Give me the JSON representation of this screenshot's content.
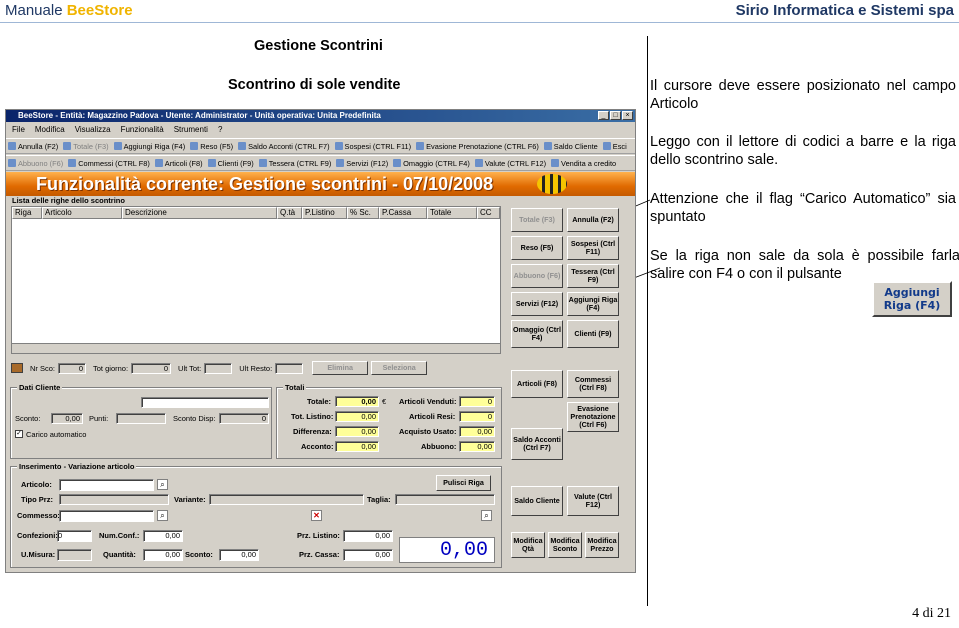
{
  "header": {
    "left_plain": "Manuale ",
    "left_brand": "BeeStore",
    "right": "Sirio Informatica e Sistemi spa"
  },
  "title": "Gestione Scontrini",
  "subtitle": "Scontrino di sole vendite",
  "notes": [
    "Il cursore deve essere posizionato nel campo Articolo",
    "Leggo con il lettore di codici a barre e la riga dello scontrino sale.",
    "Attenzione che il flag “Carico Automatico” sia spuntato",
    "Se la riga non sale da sola è possibile farla salire con F4 o con il pulsante"
  ],
  "big_button": "Aggiungi Riga (F4)",
  "page_number": "4 di 21",
  "app": {
    "title": "BeeStore - Entità: Magazzino Padova - Utente: Administrator - Unità operativa: Unita Predefinita",
    "menu": [
      "File",
      "Modifica",
      "Visualizza",
      "Funzionalità",
      "Strumenti",
      "?"
    ],
    "toolbar1": [
      "Annulla (F2)",
      "Totale (F3)",
      "Aggiungi Riga (F4)",
      "Reso (F5)",
      "Saldo Acconti (CTRL F7)",
      "Sospesi (CTRL F11)",
      "Evasione Prenotazione (CTRL F6)",
      "Saldo Cliente",
      "Esci"
    ],
    "toolbar2": [
      "Abbuono (F6)",
      "Commessi (CTRL F8)",
      "Articoli (F8)",
      "Clienti (F9)",
      "Tessera (CTRL F9)",
      "Servizi (F12)",
      "Omaggio (CTRL F4)",
      "Valute (CTRL F12)",
      "Vendita a credito"
    ],
    "banner": "Funzionalità corrente: Gestione scontrini - 07/10/2008",
    "lines_label": "Lista delle righe dello scontrino",
    "columns": [
      "Riga",
      "Articolo",
      "Descrizione",
      "Q.tà",
      "P.Listino",
      "% Sc.",
      "P.Cassa",
      "Totale",
      "CC"
    ],
    "status": {
      "nr_sco_l": "Nr Sco:",
      "nr_sco": "0",
      "tot_giorno_l": "Tot giorno:",
      "tot_giorno": "0",
      "ult_tot_l": "Ult Tot:",
      "ult_resto_l": "Ult Resto:",
      "elimina": "Elimina",
      "seleziona": "Seleziona"
    },
    "cliente": {
      "label": "Dati Cliente",
      "sconto_l": "Sconto:",
      "sconto": "0,00",
      "punti_l": "Punti:",
      "sconto_disp_l": "Sconto Disp:",
      "sconto_disp": "0",
      "carico": "Carico automatico"
    },
    "totali": {
      "label": "Totali",
      "totale_l": "Totale:",
      "totale": "0,00",
      "euro": "€",
      "venduti_l": "Articoli Venduti:",
      "venduti": "0",
      "listino_l": "Tot. Listino:",
      "listino": "0,00",
      "resi_l": "Articoli Resi:",
      "resi": "0",
      "diff_l": "Differenza:",
      "diff": "0,00",
      "usato_l": "Acquisto Usato:",
      "usato": "0,00",
      "acconto_l": "Acconto:",
      "acconto": "0,00",
      "abbuono_l": "Abbuono:",
      "abbuono": "0,00"
    },
    "ins": {
      "label": "Inserimento - Variazione articolo",
      "articolo_l": "Articolo:",
      "pulisci": "Pulisci Riga",
      "tipo_l": "Tipo Prz:",
      "variante_l": "Variante:",
      "taglia_l": "Taglia:",
      "commesso_l": "Commesso:",
      "conf_l": "Confezioni:",
      "conf": "0",
      "numconf_l": "Num.Conf.:",
      "numconf": "0,00",
      "prz_listino_l": "Prz. Listino:",
      "prz_listino": "0,00",
      "um_l": "U.Misura:",
      "qta_l": "Quantità:",
      "qta": "0,00",
      "sconto_l": "Sconto:",
      "sconto": "0,00",
      "prz_cassa_l": "Prz. Cassa:",
      "prz_cassa": "0,00",
      "big_total": "0,00"
    },
    "rbtn": [
      [
        "Totale (F3)",
        "Annulla (F2)"
      ],
      [
        "Reso (F5)",
        "Sospesi (Ctrl F11)"
      ],
      [
        "Abbuono (F6)",
        "Tessera (Ctrl F9)"
      ],
      [
        "Servizi (F12)",
        "Aggiungi Riga (F4)"
      ],
      [
        "Omaggio (Ctrl F4)",
        "Clienti (F9)"
      ],
      [
        "Articoli (F8)",
        "Commessi (Ctrl F8)"
      ],
      [
        "Saldo Acconti (Ctrl F7)",
        "Evasione Prenotazione (Ctrl F6)"
      ],
      [
        "Saldo Cliente",
        "Valute (Ctrl F12)"
      ]
    ],
    "bottom_btns": [
      "Modifica Qtà",
      "Modifica Sconto",
      "Modifica Prezzo"
    ]
  }
}
